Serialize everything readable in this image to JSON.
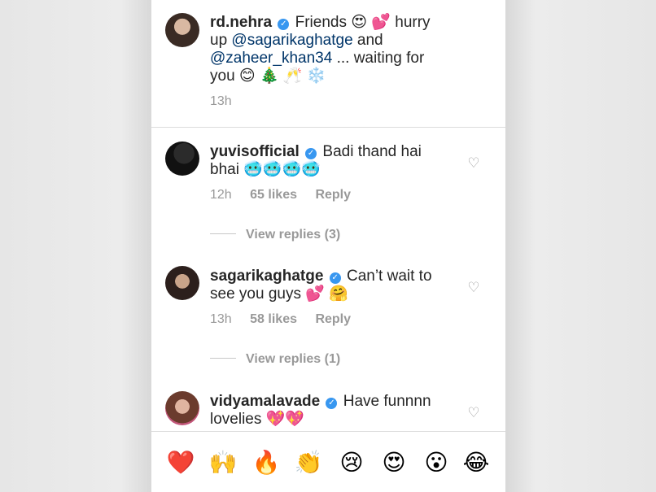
{
  "caption": {
    "username": "rd.nehra",
    "line1": "Friends 😍 💕  hurry",
    "line2_prefix": "up ",
    "mention1": "@sagarikaghatge",
    "line2_suffix": " and",
    "mention2": "@zaheer_khan34",
    "line3_suffix": " ... waiting for",
    "line4": "you 😊 🎄 🥂 ❄️",
    "time": "13h"
  },
  "comments": [
    {
      "username": "yuvisofficial",
      "text1": "Badi thand hai",
      "text2": "bhai 🥶🥶🥶🥶",
      "time": "12h",
      "likes": "65 likes",
      "reply": "Reply",
      "view_replies": "View replies (3)"
    },
    {
      "username": "sagarikaghatge",
      "text1": "Can’t wait to",
      "text2": "see you guys 💕 🤗",
      "time": "13h",
      "likes": "58 likes",
      "reply": "Reply",
      "view_replies": "View replies (1)"
    },
    {
      "username": "vidyamalavade",
      "text1": "Have funnnn",
      "text2": "lovelies 💖💖"
    }
  ],
  "emoji_bar": [
    "❤️",
    "🙌",
    "🔥",
    "👏",
    "😢",
    "😍",
    "😮",
    "😂"
  ],
  "icons": {
    "verified": "✓",
    "heart": "♡"
  }
}
